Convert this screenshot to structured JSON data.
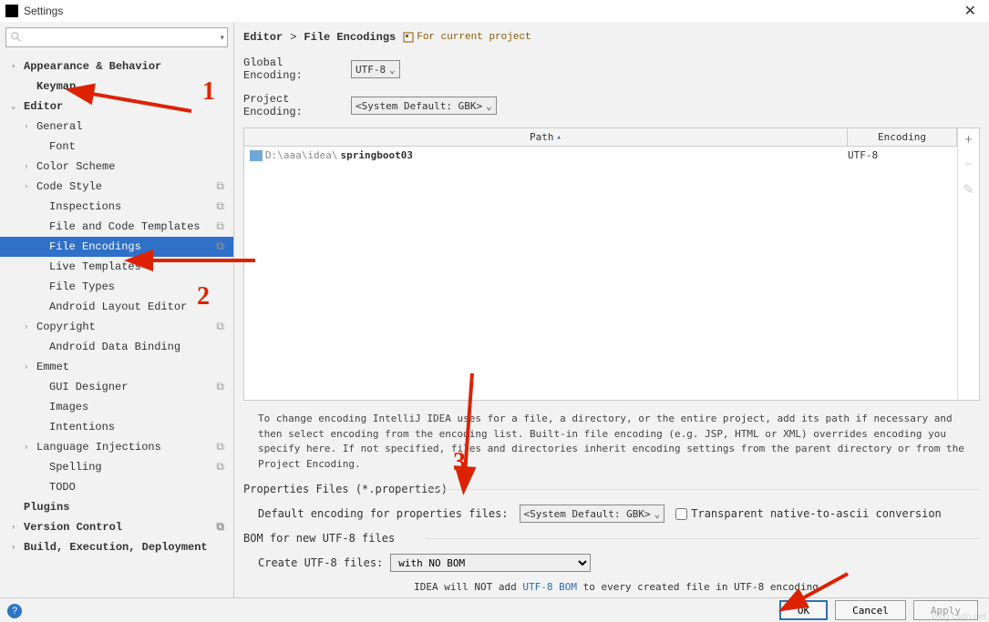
{
  "window": {
    "title": "Settings"
  },
  "sidebar": {
    "search_placeholder": "",
    "items": [
      {
        "label": "Appearance & Behavior",
        "arrow": ">",
        "bold": true
      },
      {
        "label": "Keymap",
        "arrow": "",
        "bold": true,
        "indent": 1
      },
      {
        "label": "Editor",
        "arrow": "v",
        "bold": true
      },
      {
        "label": "General",
        "arrow": ">",
        "indent": 1
      },
      {
        "label": "Font",
        "arrow": "",
        "indent": 2
      },
      {
        "label": "Color Scheme",
        "arrow": ">",
        "indent": 1
      },
      {
        "label": "Code Style",
        "arrow": ">",
        "indent": 1,
        "proj": true
      },
      {
        "label": "Inspections",
        "arrow": "",
        "indent": 2,
        "proj": true
      },
      {
        "label": "File and Code Templates",
        "arrow": "",
        "indent": 2,
        "proj": true
      },
      {
        "label": "File Encodings",
        "arrow": "",
        "indent": 2,
        "selected": true,
        "proj": true
      },
      {
        "label": "Live Templates",
        "arrow": "",
        "indent": 2
      },
      {
        "label": "File Types",
        "arrow": "",
        "indent": 2
      },
      {
        "label": "Android Layout Editor",
        "arrow": "",
        "indent": 2
      },
      {
        "label": "Copyright",
        "arrow": ">",
        "indent": 1,
        "proj": true
      },
      {
        "label": "Android Data Binding",
        "arrow": "",
        "indent": 2
      },
      {
        "label": "Emmet",
        "arrow": ">",
        "indent": 1
      },
      {
        "label": "GUI Designer",
        "arrow": "",
        "indent": 2,
        "proj": true
      },
      {
        "label": "Images",
        "arrow": "",
        "indent": 2
      },
      {
        "label": "Intentions",
        "arrow": "",
        "indent": 2
      },
      {
        "label": "Language Injections",
        "arrow": ">",
        "indent": 1,
        "proj": true
      },
      {
        "label": "Spelling",
        "arrow": "",
        "indent": 2,
        "proj": true
      },
      {
        "label": "TODO",
        "arrow": "",
        "indent": 2
      },
      {
        "label": "Plugins",
        "arrow": "",
        "bold": true
      },
      {
        "label": "Version Control",
        "arrow": ">",
        "bold": true,
        "proj": true
      },
      {
        "label": "Build, Execution, Deployment",
        "arrow": ">",
        "bold": true
      }
    ]
  },
  "breadcrumb": {
    "a": "Editor",
    "sep": ">",
    "b": "File Encodings",
    "sub": "For current project"
  },
  "encoding": {
    "global_label": "Global Encoding:",
    "global_value": "UTF-8",
    "project_label": "Project Encoding:",
    "project_value": "<System Default: GBK>"
  },
  "table": {
    "head_path": "Path",
    "head_enc": "Encoding",
    "rows": [
      {
        "path_prefix": "D:\\aaa\\idea\\",
        "path_bold": "springboot03",
        "enc": "UTF-8"
      }
    ]
  },
  "help": "To change encoding IntelliJ IDEA uses for a file, a directory, or the entire project, add its path if necessary and then select encoding from the encoding list. Built-in file encoding (e.g. JSP, HTML or XML) overrides encoding you specify here. If not specified, files and directories inherit encoding settings from the parent directory or from the Project Encoding.",
  "props": {
    "title": "Properties Files (*.properties)",
    "default_label": "Default encoding for properties files:",
    "default_value": "<System Default: GBK>",
    "checkbox_label": "Transparent native-to-ascii conversion"
  },
  "bom": {
    "title": "BOM for new UTF-8 files",
    "create_label": "Create UTF-8 files:",
    "create_value": "with NO BOM",
    "text_a": "IDEA will NOT add ",
    "text_link": "UTF-8 BOM",
    "text_b": " to every created file in UTF-8 encoding"
  },
  "footer": {
    "ok": "OK",
    "cancel": "Cancel",
    "apply": "Apply"
  },
  "watermark": "blog.csdn.net"
}
